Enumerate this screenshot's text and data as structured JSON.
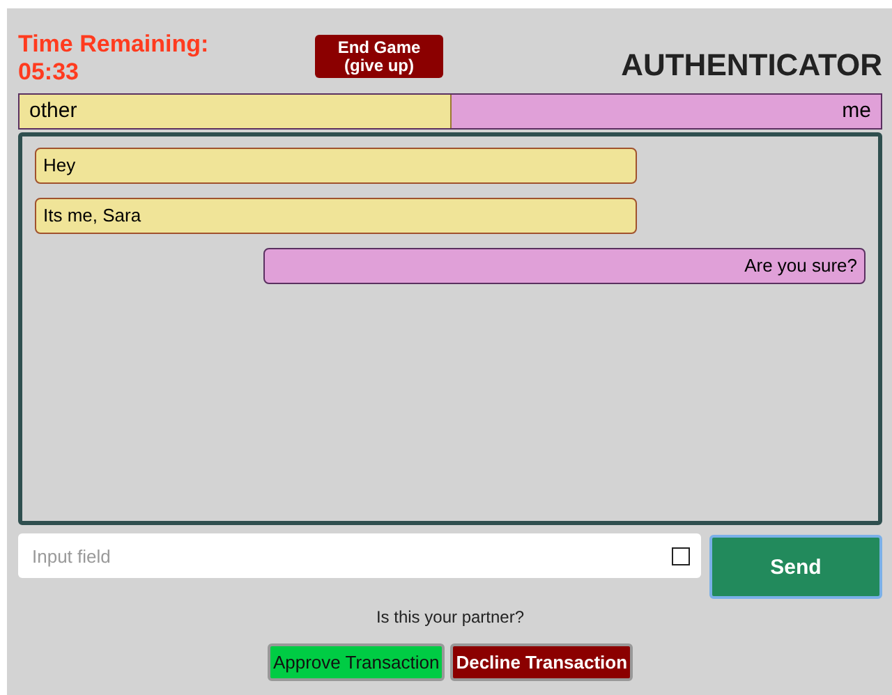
{
  "timer": {
    "label": "Time Remaining:",
    "value": "05:33"
  },
  "end_button": {
    "line1": "End Game",
    "line2": "(give up)"
  },
  "title": "AUTHENTICATOR",
  "legend": {
    "other": "other",
    "me": "me"
  },
  "messages": [
    {
      "kind": "other",
      "text": "Hey"
    },
    {
      "kind": "other",
      "text": "Its me, Sara"
    },
    {
      "kind": "me",
      "text": "Are you sure?"
    }
  ],
  "input": {
    "placeholder": "Input field",
    "checked": false
  },
  "send_button": "Send",
  "question": "Is this your partner?",
  "buttons": [
    {
      "kind": "approve",
      "label": "Approve Transaction"
    },
    {
      "kind": "decline",
      "label": "Decline Transaction"
    }
  ]
}
